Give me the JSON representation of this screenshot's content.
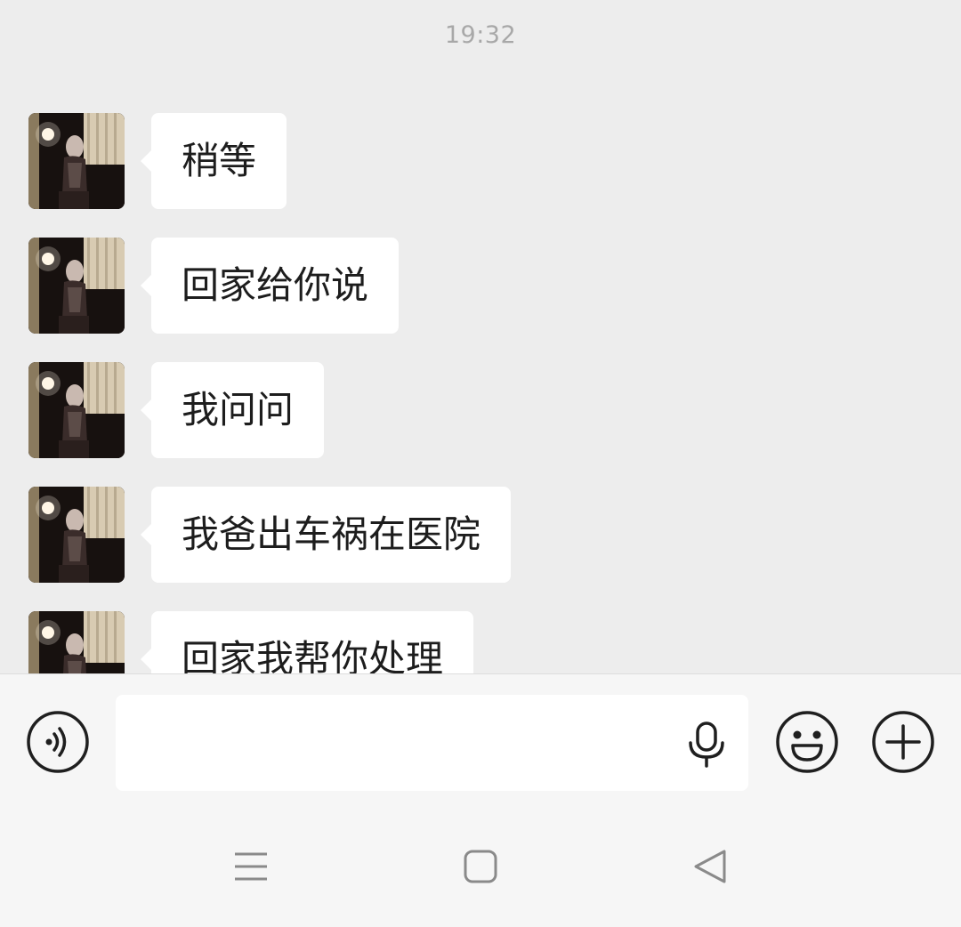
{
  "chat": {
    "timestamp": "19:32",
    "messages": [
      {
        "sender": "other",
        "text": "稍等"
      },
      {
        "sender": "other",
        "text": "回家给你说"
      },
      {
        "sender": "other",
        "text": "我问问"
      },
      {
        "sender": "other",
        "text": "我爸出车祸在医院"
      },
      {
        "sender": "other",
        "text": "回家我帮你处理"
      }
    ]
  },
  "input_bar": {
    "message_value": "",
    "voice_icon": "voice-toggle-icon",
    "mic_icon": "microphone-icon",
    "emoji_icon": "smiley-face-icon",
    "add_icon": "plus-circle-icon"
  },
  "nav_bar": {
    "menu_icon": "menu-lines-icon",
    "home_icon": "rounded-square-icon",
    "back_icon": "triangle-back-icon"
  },
  "colors": {
    "background": "#ededed",
    "bubble": "#ffffff",
    "text": "#1d1d1d",
    "timestamp": "#a8a8a8",
    "toolbar": "#f6f6f6",
    "icon": "#1f1f1f",
    "nav_icon": "#8a8a8a"
  }
}
